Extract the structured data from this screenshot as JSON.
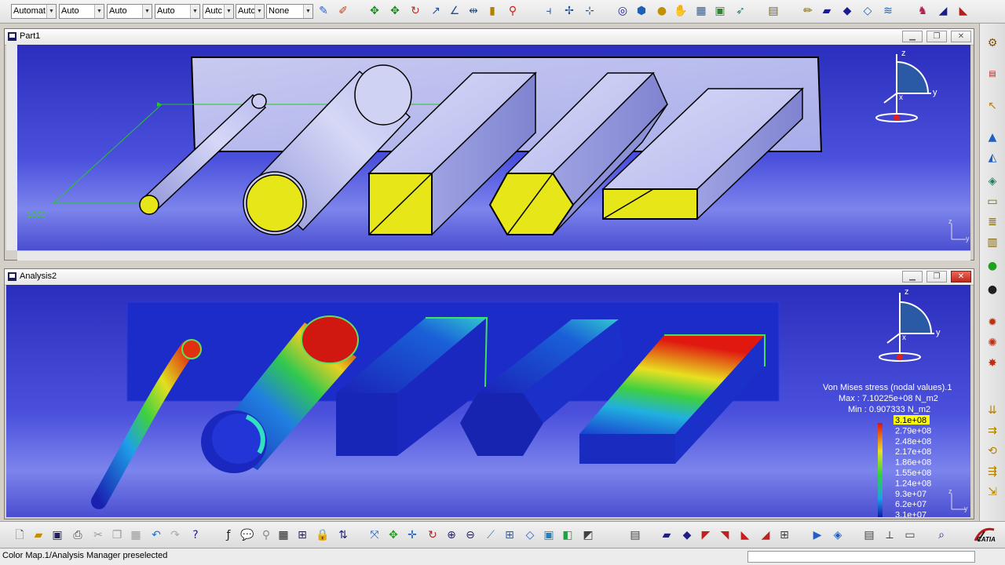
{
  "toolbar": {
    "dropdowns": [
      {
        "value": "Automat"
      },
      {
        "value": "Auto"
      },
      {
        "value": "Auto"
      },
      {
        "value": "Auto"
      },
      {
        "value": "Autc"
      },
      {
        "value": "Autc"
      },
      {
        "value": "None"
      }
    ]
  },
  "part_window": {
    "title": "Part1",
    "dimension_label": "1000",
    "compass_labels": {
      "z": "z",
      "y": "y",
      "x": "x"
    },
    "mini_axis": {
      "z": "z",
      "y": "y"
    }
  },
  "analysis_window": {
    "title": "Analysis2",
    "compass_labels": {
      "z": "z",
      "y": "y",
      "x": "x"
    },
    "mini_axis": {
      "z": "z",
      "y": "y"
    },
    "legend": {
      "title": "Von Mises stress (nodal values).1",
      "max": "Max : 7.10225e+08 N_m2",
      "min": "Min : 0.907333 N_m2",
      "values": [
        "3.1e+08",
        "2.79e+08",
        "2.48e+08",
        "2.17e+08",
        "1.86e+08",
        "1.55e+08",
        "1.24e+08",
        "9.3e+07",
        "6.2e+07",
        "3.1e+07"
      ],
      "highlight_color": "#ffff00"
    }
  },
  "status": {
    "text": "Color Map.1/Analysis Manager preselected"
  },
  "brand": {
    "logo_text": "CATIA"
  },
  "colors": {
    "viewport_blue": "#3438c8",
    "section_yellow": "#e6e619",
    "close_red": "#c8281c"
  }
}
